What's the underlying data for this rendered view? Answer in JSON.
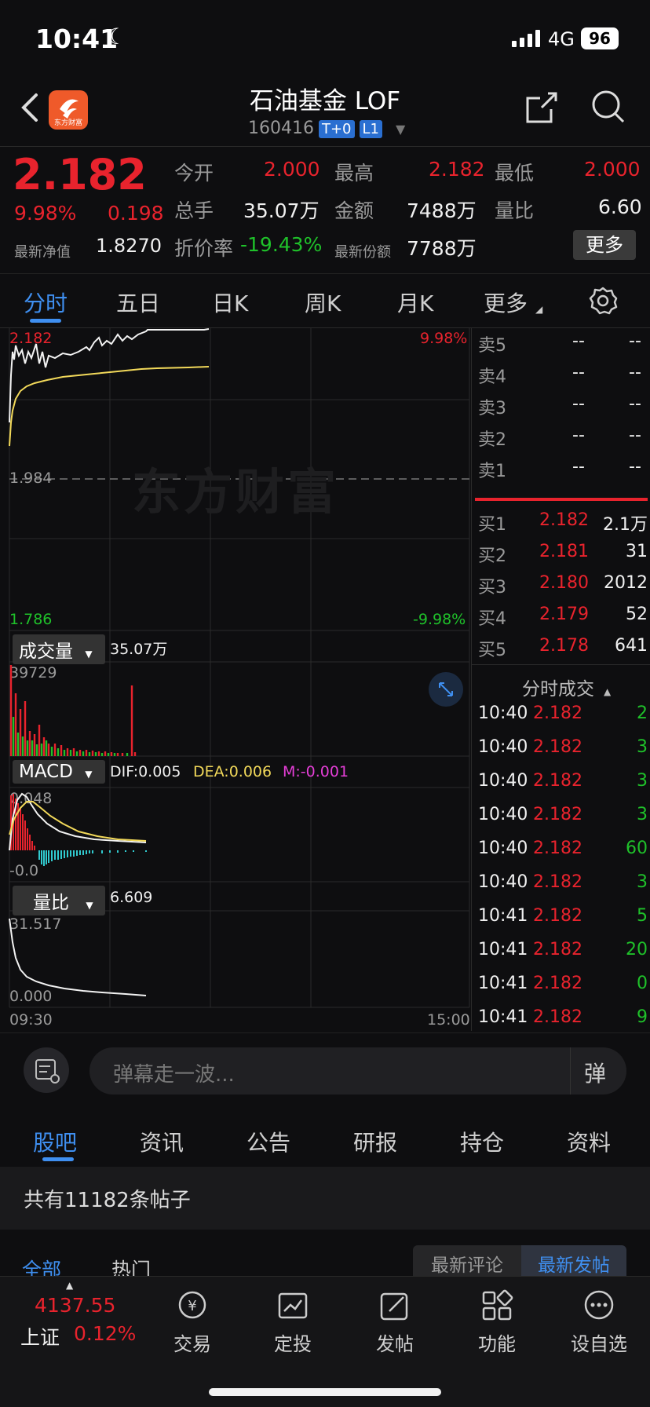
{
  "status": {
    "time": "10:41",
    "network": "4G",
    "battery": "96"
  },
  "header": {
    "title": "石油基金 LOF",
    "code": "160416",
    "tag1": "T+0",
    "tag2": "L1",
    "logo_text": "东方财富"
  },
  "quote": {
    "price": "2.182",
    "change_pct": "9.98%",
    "change": "0.198",
    "nav_label": "最新净值",
    "nav": "1.8270",
    "open_label": "今开",
    "open": "2.000",
    "high_label": "最高",
    "high": "2.182",
    "low_label": "最低",
    "low": "2.000",
    "vol_label": "总手",
    "vol": "35.07万",
    "amt_label": "金额",
    "amt": "7488万",
    "ratio_label": "量比",
    "ratio": "6.60",
    "disc_label": "折价率",
    "disc": "-19.43%",
    "share_label": "最新份额",
    "share": "7788万",
    "more": "更多"
  },
  "tabs": [
    "分时",
    "五日",
    "日K",
    "周K",
    "月K",
    "更多"
  ],
  "chart": {
    "top_price": "2.182",
    "top_pct": "9.98%",
    "mid_price": "1.984",
    "low_price": "1.786",
    "low_pct": "-9.98%",
    "watermark": "东方财富",
    "vol_label": "成交量",
    "vol_value": "35.07万",
    "vol_max": "39729",
    "macd_label": "MACD",
    "dif": "DIF:0.005",
    "dea": "DEA:0.006",
    "m": "M:-0.001",
    "macd_top": "0.048",
    "macd_bottom": "-0.0",
    "lb_label": "量比",
    "lb_value": "6.609",
    "lb_top": "31.517",
    "lb_bottom": "0.000",
    "t_start": "09:30",
    "t_end": "15:00"
  },
  "book": {
    "sells": [
      {
        "label": "卖5",
        "price": "--",
        "vol": "--"
      },
      {
        "label": "卖4",
        "price": "--",
        "vol": "--"
      },
      {
        "label": "卖3",
        "price": "--",
        "vol": "--"
      },
      {
        "label": "卖2",
        "price": "--",
        "vol": "--"
      },
      {
        "label": "卖1",
        "price": "--",
        "vol": "--"
      }
    ],
    "buys": [
      {
        "label": "买1",
        "price": "2.182",
        "vol": "2.1万"
      },
      {
        "label": "买2",
        "price": "2.181",
        "vol": "31"
      },
      {
        "label": "买3",
        "price": "2.180",
        "vol": "2012"
      },
      {
        "label": "买4",
        "price": "2.179",
        "vol": "52"
      },
      {
        "label": "买5",
        "price": "2.178",
        "vol": "641"
      }
    ],
    "ticks_title": "分时成交",
    "ticks": [
      {
        "t": "10:40",
        "p": "2.182",
        "v": "2"
      },
      {
        "t": "10:40",
        "p": "2.182",
        "v": "3"
      },
      {
        "t": "10:40",
        "p": "2.182",
        "v": "3"
      },
      {
        "t": "10:40",
        "p": "2.182",
        "v": "3"
      },
      {
        "t": "10:40",
        "p": "2.182",
        "v": "60"
      },
      {
        "t": "10:40",
        "p": "2.182",
        "v": "3"
      },
      {
        "t": "10:41",
        "p": "2.182",
        "v": "5"
      },
      {
        "t": "10:41",
        "p": "2.182",
        "v": "20"
      },
      {
        "t": "10:41",
        "p": "2.182",
        "v": "0"
      },
      {
        "t": "10:41",
        "p": "2.182",
        "v": "9"
      }
    ]
  },
  "danmu": {
    "placeholder": "弹幕走一波...",
    "btn": "弹"
  },
  "forum": {
    "tabs": [
      "股吧",
      "资讯",
      "公告",
      "研报",
      "持仓",
      "资料"
    ],
    "count_text": "共有11182条帖子",
    "filter_all": "全部",
    "filter_hot": "热门",
    "sort_comment": "最新评论",
    "sort_post": "最新发帖"
  },
  "bottom": {
    "index_value": "4137.55",
    "index_name": "上证",
    "index_pct": "0.12%",
    "items": [
      "交易",
      "定投",
      "发帖",
      "功能",
      "设自选"
    ]
  }
}
